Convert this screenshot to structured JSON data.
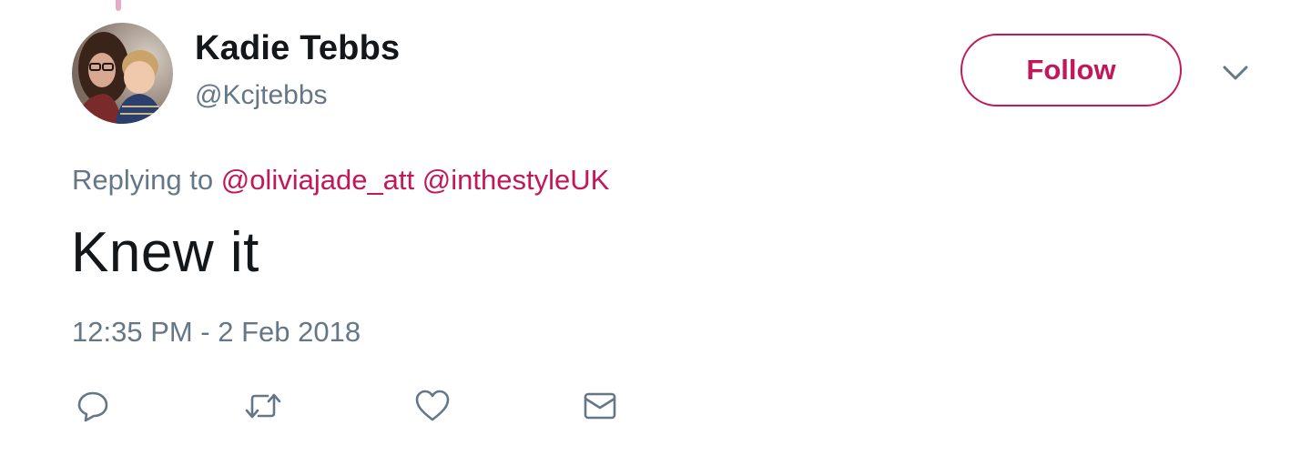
{
  "user": {
    "display_name": "Kadie Tebbs",
    "handle": "@Kcjtebbs",
    "avatar_icon": "profile-photo"
  },
  "follow_button": {
    "label": "Follow"
  },
  "menu": {
    "icon": "chevron-down-icon"
  },
  "tweet": {
    "reply_prefix": "Replying to",
    "mentions": [
      "@oliviajade_att",
      "@inthestyleUK"
    ],
    "text": "Knew it",
    "timestamp": "12:35 PM - 2 Feb 2018"
  },
  "actions": [
    {
      "icon": "reply-icon"
    },
    {
      "icon": "retweet-icon"
    },
    {
      "icon": "like-heart-icon"
    },
    {
      "icon": "direct-message-icon"
    }
  ],
  "colors": {
    "accent": "#c2185b",
    "text_primary": "#14171a",
    "text_secondary": "#657786",
    "icon_gray": "#657786",
    "thread_line": "#e8a9c8"
  }
}
